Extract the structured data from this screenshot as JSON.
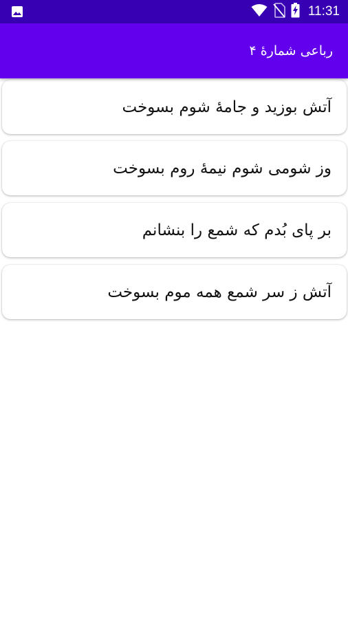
{
  "status_bar": {
    "time": "11:31",
    "icons": [
      "image-icon",
      "wifi-icon",
      "no-sim-icon",
      "battery-charging-icon"
    ],
    "background": "#3700b3"
  },
  "app_bar": {
    "title": "رباعی شمارهٔ ۴",
    "background": "#6200ee"
  },
  "verses": [
    {
      "text": "آتش بوزید و جامهٔ شوم بسوخت"
    },
    {
      "text": "وز شومی شوم نیمهٔ روم بسوخت"
    },
    {
      "text": "بر پای بُدم که شمع را بنشانم"
    },
    {
      "text": "آتش ز سر شمع همه موم بسوخت"
    }
  ]
}
